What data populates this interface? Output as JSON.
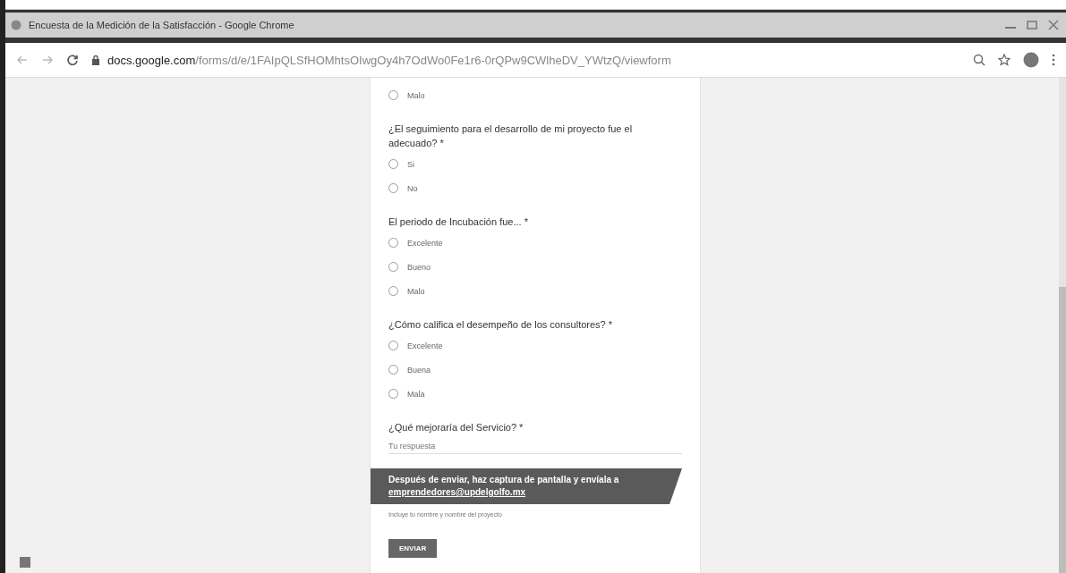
{
  "window": {
    "title": "Encuesta de la Medición de la Satisfacción - Google Chrome"
  },
  "address_bar": {
    "domain": "docs.google.com",
    "path": "/forms/d/e/1FAIpQLSfHOMhtsOIwgOy4h7OdWo0Fe1r6-0rQPw9CWlheDV_YWtzQ/viewform"
  },
  "form": {
    "items": [
      {
        "kind": "option",
        "label": "Malo",
        "selected": false
      },
      {
        "kind": "question",
        "title": "¿El seguimiento para el desarrollo de mi proyecto fue el adecuado?",
        "mark": "*"
      },
      {
        "kind": "option",
        "label": "Si",
        "selected": false
      },
      {
        "kind": "option",
        "label": "No",
        "selected": false
      },
      {
        "kind": "question",
        "title": "El periodo de Incubación fue...",
        "mark": "*"
      },
      {
        "kind": "option",
        "label": "Excelente",
        "selected": false
      },
      {
        "kind": "option",
        "label": "Bueno",
        "selected": false
      },
      {
        "kind": "option",
        "label": "Malo",
        "selected": false
      },
      {
        "kind": "question",
        "title": "¿Cómo califica el desempeño de los consultores?",
        "mark": "*"
      },
      {
        "kind": "option",
        "label": "Excelente",
        "selected": false
      },
      {
        "kind": "option",
        "label": "Buena",
        "selected": false
      },
      {
        "kind": "option",
        "label": "Mala",
        "selected": false
      },
      {
        "kind": "question",
        "title": "¿Qué mejoraría del Servicio?",
        "mark": "*"
      },
      {
        "kind": "text_answer",
        "placeholder": "Tu respuesta"
      }
    ],
    "banner": {
      "text": "Después de enviar, haz captura de pantalla y envíala a",
      "email": "emprendedores@updelgolfo.mx"
    },
    "note": "Incluye tu nombre y nombre del proyecto",
    "submit": "ENVIAR"
  }
}
